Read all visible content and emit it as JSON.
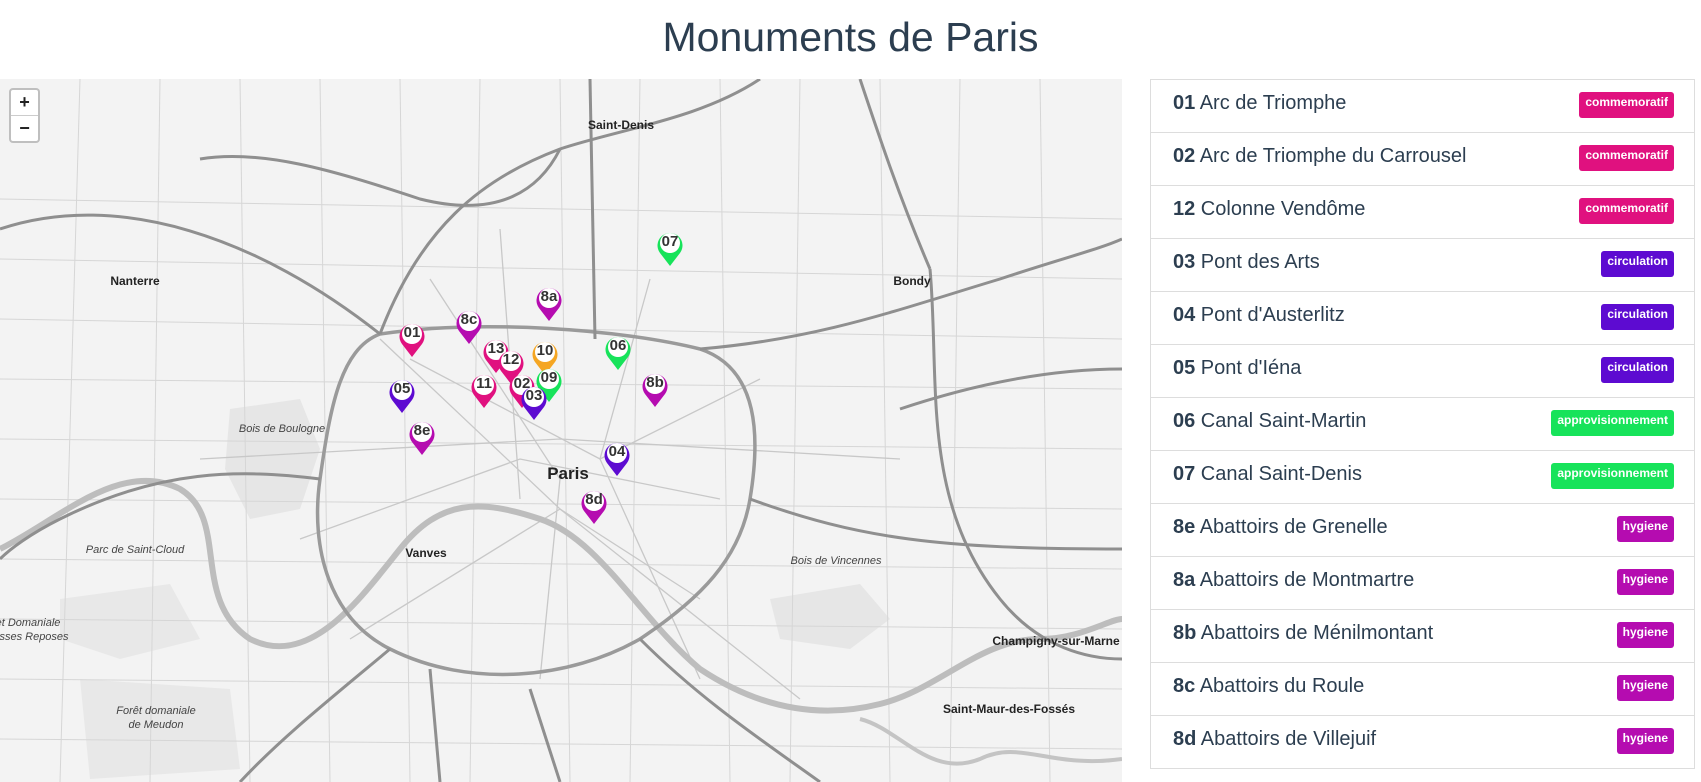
{
  "title": "Monuments de Paris",
  "zoom": {
    "in_label": "+",
    "out_label": "−"
  },
  "colors": {
    "commemoratif": "#e0117f",
    "circulation": "#5d0bd1",
    "approvisionnement": "#17e35a",
    "hygiene": "#b50cb0",
    "orange": "#f5a623"
  },
  "places": [
    {
      "label": "Saint-Denis",
      "style": "bold"
    },
    {
      "label": "Nanterre",
      "style": "bold"
    },
    {
      "label": "Bondy",
      "style": "bold"
    },
    {
      "label": "Bois de Boulogne",
      "style": "it"
    },
    {
      "label": "Paris",
      "style": "city"
    },
    {
      "label": "Parc de Saint-Cloud",
      "style": "it"
    },
    {
      "label": "Vanves",
      "style": "bold"
    },
    {
      "label": "Bois de Vincennes",
      "style": "it"
    },
    {
      "label": "Champigny-sur-Marne",
      "style": "bold"
    },
    {
      "label": "Saint-Maur-des-Fossés",
      "style": "bold"
    },
    {
      "label": "Forêt domaniale",
      "style": "it"
    },
    {
      "label": "de Meudon",
      "style": "it"
    },
    {
      "label": "et Domaniale",
      "style": "it"
    },
    {
      "label": "sses Reposes",
      "style": "it"
    }
  ],
  "markers": [
    {
      "label": "07",
      "category": "approvisionnement"
    },
    {
      "label": "8a",
      "category": "hygiene"
    },
    {
      "label": "8c",
      "category": "hygiene"
    },
    {
      "label": "01",
      "category": "commemoratif"
    },
    {
      "label": "13",
      "category": "commemoratif"
    },
    {
      "label": "10",
      "category": "orange"
    },
    {
      "label": "12",
      "category": "commemoratif"
    },
    {
      "label": "06",
      "category": "approvisionnement"
    },
    {
      "label": "11",
      "category": "commemoratif"
    },
    {
      "label": "02",
      "category": "commemoratif"
    },
    {
      "label": "09",
      "category": "approvisionnement"
    },
    {
      "label": "8b",
      "category": "hygiene"
    },
    {
      "label": "05",
      "category": "circulation"
    },
    {
      "label": "03",
      "category": "circulation"
    },
    {
      "label": "8e",
      "category": "hygiene"
    },
    {
      "label": "04",
      "category": "circulation"
    },
    {
      "label": "8d",
      "category": "hygiene"
    }
  ],
  "monuments": [
    {
      "num": "01",
      "name": "Arc de Triomphe",
      "badge": "commemoratif",
      "category": "commemoratif"
    },
    {
      "num": "02",
      "name": "Arc de Triomphe du Carrousel",
      "badge": "commemoratif",
      "category": "commemoratif"
    },
    {
      "num": "12",
      "name": "Colonne Vendôme",
      "badge": "commemoratif",
      "category": "commemoratif"
    },
    {
      "num": "03",
      "name": "Pont des Arts",
      "badge": "circulation",
      "category": "circulation"
    },
    {
      "num": "04",
      "name": "Pont d'Austerlitz",
      "badge": "circulation",
      "category": "circulation"
    },
    {
      "num": "05",
      "name": "Pont d'Iéna",
      "badge": "circulation",
      "category": "circulation"
    },
    {
      "num": "06",
      "name": "Canal Saint-Martin",
      "badge": "approvisionnement",
      "category": "approvisionnement"
    },
    {
      "num": "07",
      "name": "Canal Saint-Denis",
      "badge": "approvisionnement",
      "category": "approvisionnement"
    },
    {
      "num": "8e",
      "name": "Abattoirs de Grenelle",
      "badge": "hygiene",
      "category": "hygiene"
    },
    {
      "num": "8a",
      "name": "Abattoirs de Montmartre",
      "badge": "hygiene",
      "category": "hygiene"
    },
    {
      "num": "8b",
      "name": "Abattoirs de Ménilmontant",
      "badge": "hygiene",
      "category": "hygiene"
    },
    {
      "num": "8c",
      "name": "Abattoirs du Roule",
      "badge": "hygiene",
      "category": "hygiene"
    },
    {
      "num": "8d",
      "name": "Abattoirs de Villejuif",
      "badge": "hygiene",
      "category": "hygiene"
    }
  ]
}
